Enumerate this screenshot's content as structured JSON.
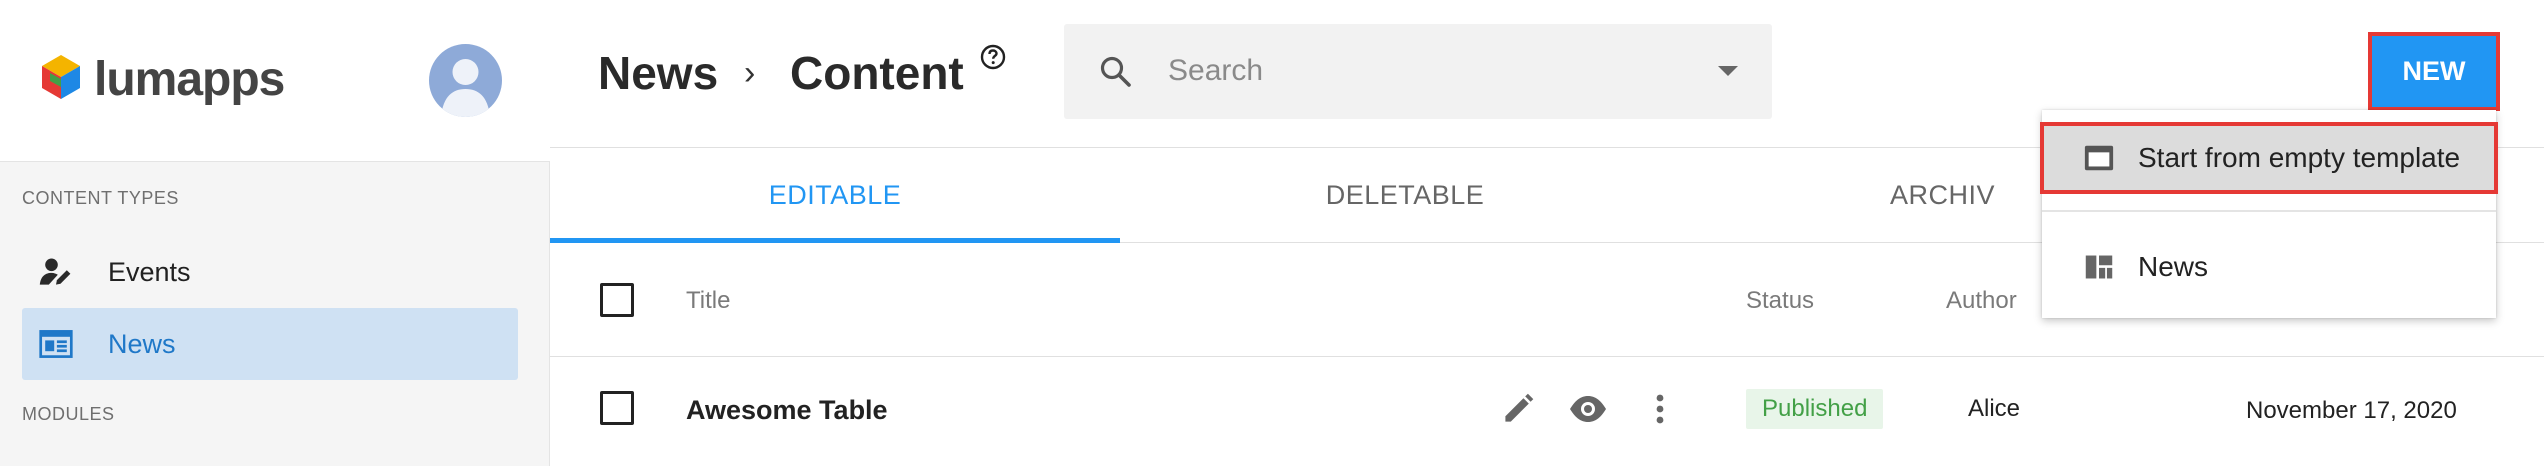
{
  "brand": {
    "name": "lumapps"
  },
  "sidebar": {
    "content_types_label": "CONTENT TYPES",
    "items": [
      {
        "label": "Events",
        "icon": "person-edit-icon",
        "active": false
      },
      {
        "label": "News",
        "icon": "news-icon",
        "active": true
      }
    ],
    "modules_label": "MODULES"
  },
  "header": {
    "breadcrumb": [
      "News",
      "Content"
    ],
    "search_placeholder": "Search",
    "new_button": "NEW"
  },
  "tabs": [
    {
      "label": "EDITABLE",
      "active": true
    },
    {
      "label": "DELETABLE",
      "active": false
    },
    {
      "label": "ARCHIV",
      "active": false
    }
  ],
  "table": {
    "columns": [
      "Title",
      "Status",
      "Author"
    ],
    "rows": [
      {
        "title": "Awesome Table",
        "status": "Published",
        "author": "Alice",
        "date": "November 17, 2020"
      }
    ]
  },
  "dropdown": {
    "items": [
      {
        "label": "Start from empty template",
        "icon": "template-icon"
      },
      {
        "label": "News",
        "icon": "dashboard-icon"
      }
    ]
  },
  "colors": {
    "accent": "#2196f3",
    "highlight_border": "#e53935",
    "status_published": "#43a047"
  }
}
